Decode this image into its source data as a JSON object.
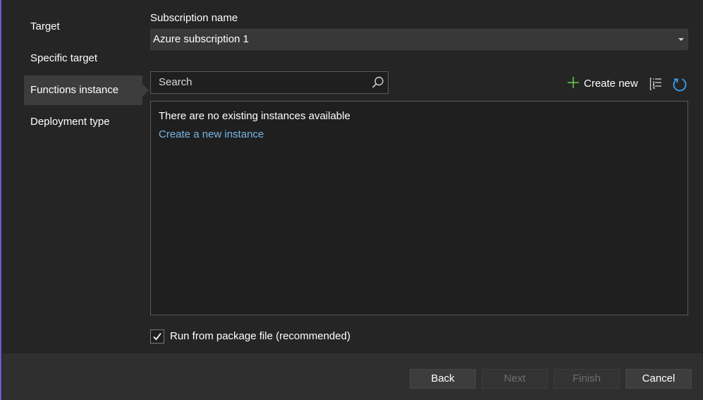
{
  "sidebar": {
    "items": [
      {
        "label": "Target"
      },
      {
        "label": "Specific target"
      },
      {
        "label": "Functions instance"
      },
      {
        "label": "Deployment type"
      }
    ],
    "selected_index": 2
  },
  "subscription": {
    "label": "Subscription name",
    "value": "Azure subscription 1"
  },
  "search": {
    "placeholder": "Search",
    "icon": "search-icon"
  },
  "toolbar": {
    "create_new_label": "Create new",
    "create_new_icon": "plus-icon",
    "filter_icon": "filter-icon",
    "refresh_icon": "refresh-icon"
  },
  "instances": {
    "empty_message": "There are no existing instances available",
    "create_link": "Create a new instance"
  },
  "package_option": {
    "label": "Run from package file (recommended)",
    "checked": true
  },
  "buttons": {
    "back": "Back",
    "next": "Next",
    "finish": "Finish",
    "cancel": "Cancel"
  },
  "colors": {
    "accent": "#6b5ec9",
    "link": "#75b6e7",
    "plus": "#6cc24a",
    "refresh": "#3aa0f3"
  }
}
